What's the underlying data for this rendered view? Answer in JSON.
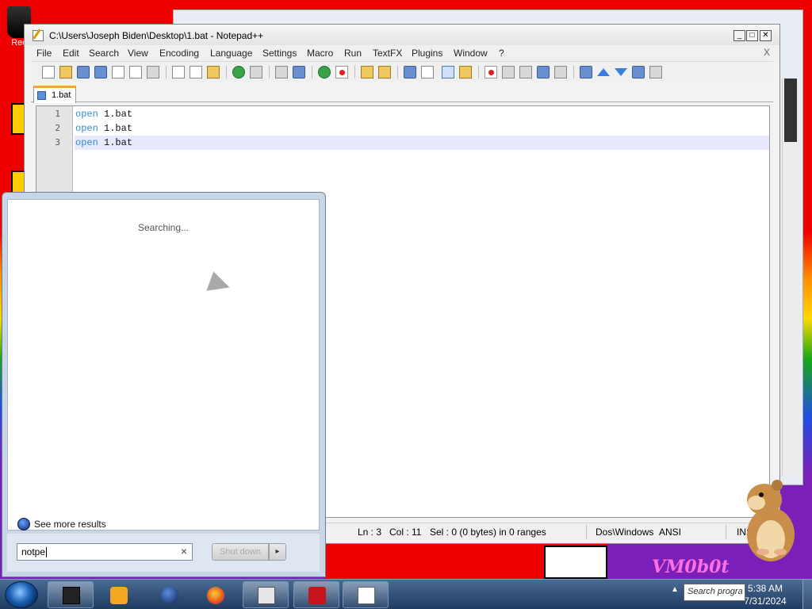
{
  "desktop": {
    "recycle_label": "Rec",
    "wallpaper_logo": "VM0b0t"
  },
  "notepad": {
    "title": "C:\\Users\\Joseph Biden\\Desktop\\1.bat - Notepad++",
    "menu": [
      "File",
      "Edit",
      "Search",
      "View",
      "Encoding",
      "Language",
      "Settings",
      "Macro",
      "Run",
      "TextFX",
      "Plugins",
      "Window",
      "?"
    ],
    "menu_close": "X",
    "tab_label": "1.bat",
    "lines": [
      {
        "num": "1",
        "keyword": "open",
        "arg": "1.bat"
      },
      {
        "num": "2",
        "keyword": "open",
        "arg": "1.bat"
      },
      {
        "num": "3",
        "keyword": "open",
        "arg": "1.bat"
      }
    ],
    "status": {
      "ln": "Ln : 3",
      "col": "Col : 11",
      "sel": "Sel : 0 (0 bytes) in 0 ranges",
      "eol": "Dos\\Windows",
      "encoding": "ANSI",
      "mode": "INS"
    }
  },
  "startmenu": {
    "searching_text": "Searching...",
    "see_more": "See more results",
    "search_value": "notpe",
    "clear_glyph": "×",
    "shutdown_label": "Shut down",
    "shutdown_arrow": "▸"
  },
  "taskbar": {
    "time": "5:38 AM",
    "date": "7/31/2024",
    "search_hint": "Search progra",
    "tray_chevron": "▲"
  },
  "colors": {
    "accent": "#2e8dd2",
    "tab_highlight": "#f6a341",
    "current_line": "#e8e8ff"
  }
}
